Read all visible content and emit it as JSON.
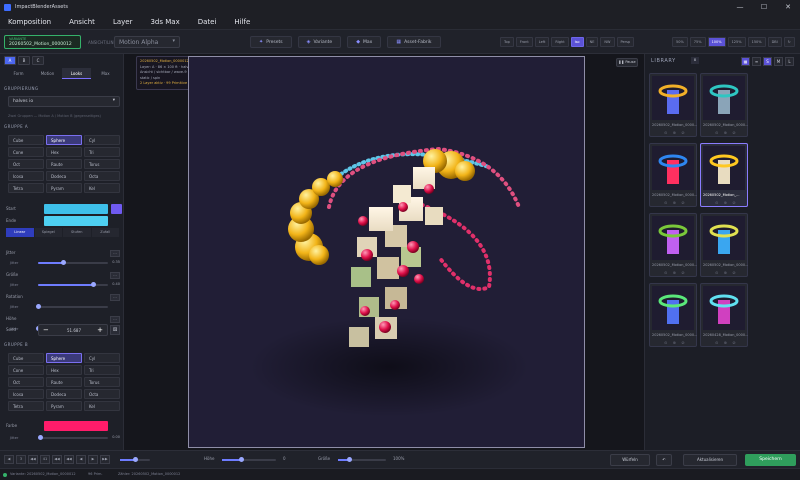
{
  "window": {
    "title": "ImpactBlenderAssets",
    "controls": [
      "—",
      "☐",
      "✕"
    ]
  },
  "menu": [
    "Komposition",
    "Ansicht",
    "Layer",
    "3ds Max",
    "Datei",
    "Hilfe"
  ],
  "toolbar": {
    "variant_label": "VARIANTE",
    "variant_name": "20260502_Motion_0000012",
    "preset_label": "ANSICHT/LINK",
    "preset_value": "Motion Alpha",
    "tabs": [
      {
        "icon": "✦",
        "label": "Presets"
      },
      {
        "icon": "◈",
        "label": "Variante"
      },
      {
        "icon": "◆",
        "label": "Max"
      },
      {
        "icon": "▦",
        "label": "Asset-Fabrik"
      }
    ],
    "views": [
      "Top",
      "Front",
      "Left",
      "Right",
      "Iso",
      "NE",
      "NW",
      "Persp"
    ],
    "active_view": "Iso",
    "zoom": [
      "50%",
      "75%",
      "100%",
      "125%",
      "150%",
      "DBl",
      "↻"
    ],
    "active_zoom": "100%"
  },
  "left_panel": {
    "modes": [
      "A",
      "B",
      "C"
    ],
    "tabs": [
      "Form",
      "Motion",
      "Looks",
      "Max"
    ],
    "active_tab": "Looks",
    "grouping_label": "GRUPPIERUNG",
    "grouping_value": "halves io",
    "breadcrumb": "Zwei Gruppen — Motion A / Motion B (gegenseitiges)",
    "group_a_label": "GRUPPE A",
    "group_b_label": "GRUPPE B",
    "shapes": [
      "Cube",
      "Sphere",
      "Cyl",
      "Cone",
      "Hex",
      "Tri",
      "Oct",
      "Raute",
      "Torus",
      "Icosa",
      "Dodeca",
      "Octa",
      "Tetra",
      "Pyram",
      "Kel"
    ],
    "active_shape": "Sphere",
    "start_label": "Start",
    "end_label": "Ende",
    "start_color": "#3ec0ea",
    "end_color": "#4ed0f2",
    "blend_tabs": [
      "Linear",
      "Spiegel",
      "Stufen",
      "Zufall"
    ],
    "active_blend": "Linear",
    "params": [
      {
        "name": "Jitter",
        "jitter": "Jitter",
        "value": "0.35",
        "level": 0.35
      },
      {
        "name": "Größe",
        "jitter": "Jitter",
        "value": "0.40",
        "level": 0.78
      },
      {
        "name": "Rotation",
        "jitter": "Jitter",
        "value": "",
        "level": 0.0
      },
      {
        "name": "Höhe",
        "jitter": "Jitter",
        "value": "",
        "level": 0.0
      }
    ],
    "seed_label": "Seed",
    "seed_value": "51.687",
    "farbe_label": "Farbe",
    "farbe_color": "#ff1c6a",
    "farbe_jitter": "Jitter",
    "farbe_value": "0.00"
  },
  "viewport": {
    "overlay": [
      "20260502_Motion_0000012",
      "Layer: A  ·  86 × 100 ft  ·  halves io",
      "Ansicht / sichtbar / wave-9",
      "static / spin",
      "2 Layer aktiv  ·  99 Primitive gesamt"
    ],
    "pause_label": "❚❚ Pause"
  },
  "library": {
    "title": "LIBRARY",
    "count": "8",
    "ctrls": [
      "▦",
      "≡",
      "S",
      "M",
      "L"
    ],
    "items": [
      {
        "label": "20260502_Motion_0000...",
        "ring": "#f2b028",
        "tower": "#5a6cf0",
        "selected": false
      },
      {
        "label": "20260502_Motion_0000...",
        "ring": "#2ec6c2",
        "tower": "#8aa4b8",
        "selected": false
      },
      {
        "label": "20260502_Motion_0000...",
        "ring": "#2e86f0",
        "tower": "#ff3060",
        "selected": false
      },
      {
        "label": "20260502_Motion_...",
        "ring": "#ffc820",
        "tower": "#e8dcc0",
        "selected": true
      },
      {
        "label": "20260502_Motion_0000...",
        "ring": "#7ac83a",
        "tower": "#c060f0",
        "selected": false
      },
      {
        "label": "20260502_Motion_0000...",
        "ring": "#e0e050",
        "tower": "#3aa6f0",
        "selected": false
      },
      {
        "label": "20260502_Motion_0000...",
        "ring": "#5ae87a",
        "tower": "#5070f0",
        "selected": false
      },
      {
        "label": "20260428_Motion_0000...",
        "ring": "#60e0f0",
        "tower": "#d040c0",
        "selected": false
      }
    ]
  },
  "bottom": {
    "nav": [
      "◀",
      "3",
      "◀◀",
      "41",
      "◀◀",
      "◀◀",
      "◀",
      "▶",
      "▶▶"
    ],
    "hoehe_label": "Höhe",
    "hoehe_value": "0",
    "groesse_label": "Größe",
    "groesse_value": "100%",
    "wuerfeln": "Würfeln",
    "aktualisieren": "Aktualisieren",
    "speichern": "Speichern"
  },
  "status": {
    "variant": "Variante: 20260502_Motion_0000012",
    "primitives": "96 Prim.",
    "counter": "Zähler: 20260502_Motion_0000012"
  }
}
